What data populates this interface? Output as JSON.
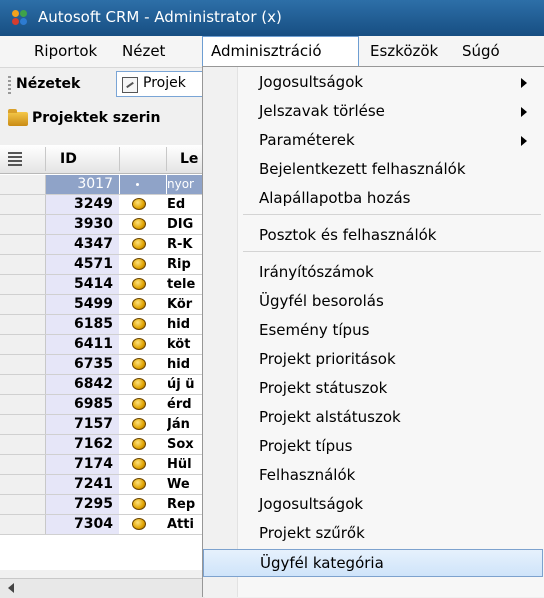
{
  "window": {
    "title": "Autosoft CRM - Administrator (x)"
  },
  "menubar": {
    "items": [
      {
        "label": "Riportok"
      },
      {
        "label": "Nézet"
      },
      {
        "label": "Adminisztráció"
      },
      {
        "label": "Eszközök"
      },
      {
        "label": "Súgó"
      }
    ]
  },
  "toolbar": {
    "label": "Nézetek",
    "button_label": "Projek"
  },
  "section": {
    "title": "Projektek szerin"
  },
  "grid": {
    "columns": [
      "ID",
      "Le"
    ],
    "rows": [
      {
        "id": "3017",
        "text": "nyor",
        "icon": "none",
        "selected": true
      },
      {
        "id": "3249",
        "text": "Ed",
        "icon": "coin-icon"
      },
      {
        "id": "3930",
        "text": "DIG",
        "icon": "coin-icon"
      },
      {
        "id": "4347",
        "text": "R-K",
        "icon": "coin-icon"
      },
      {
        "id": "4571",
        "text": "Rip",
        "icon": "coin-icon"
      },
      {
        "id": "5414",
        "text": "tele",
        "icon": "coin-icon"
      },
      {
        "id": "5499",
        "text": "Kör",
        "icon": "coin-icon"
      },
      {
        "id": "6185",
        "text": "hid",
        "icon": "coin-icon"
      },
      {
        "id": "6411",
        "text": "köt",
        "icon": "coin-icon"
      },
      {
        "id": "6735",
        "text": "hid",
        "icon": "coin-icon"
      },
      {
        "id": "6842",
        "text": "új ü",
        "icon": "coin-icon"
      },
      {
        "id": "6985",
        "text": "érd",
        "icon": "coin-icon"
      },
      {
        "id": "7157",
        "text": "Ján",
        "icon": "coin-icon"
      },
      {
        "id": "7162",
        "text": "Sox",
        "icon": "coin-icon"
      },
      {
        "id": "7174",
        "text": "Hül",
        "icon": "coin-icon"
      },
      {
        "id": "7241",
        "text": "We",
        "icon": "coin-icon"
      },
      {
        "id": "7295",
        "text": "Rep",
        "icon": "coin-icon"
      },
      {
        "id": "7304",
        "text": "Atti",
        "icon": "coin-icon"
      }
    ]
  },
  "dropdown": {
    "items": [
      {
        "label": "Jogosultságok",
        "submenu": true
      },
      {
        "label": "Jelszavak törlése",
        "submenu": true
      },
      {
        "label": "Paraméterek",
        "submenu": true
      },
      {
        "label": "Bejelentkezett felhasználók"
      },
      {
        "label": "Alapállapotba hozás"
      },
      {
        "label": "Posztok és felhasználók"
      },
      {
        "label": "Irányítószámok"
      },
      {
        "label": "Ügyfél besorolás"
      },
      {
        "label": "Esemény típus"
      },
      {
        "label": "Projekt prioritások"
      },
      {
        "label": "Projekt státuszok"
      },
      {
        "label": "Projekt alstátuszok"
      },
      {
        "label": "Projekt típus"
      },
      {
        "label": "Felhasználók"
      },
      {
        "label": "Jogosultságok"
      },
      {
        "label": "Projekt szűrők"
      },
      {
        "label": "Ügyfél kategória",
        "highlighted": true
      }
    ]
  },
  "colors": {
    "title_bar": "#1f5c96",
    "selection": "#8fa3c8",
    "highlight_border": "#7da2ce"
  }
}
